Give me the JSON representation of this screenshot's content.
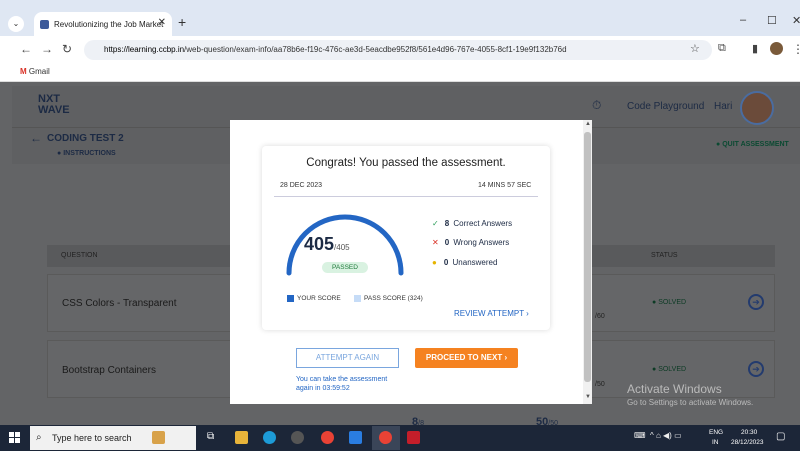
{
  "browser": {
    "tab_title": "Revolutionizing the Job Market",
    "url_host": "https://learning.ccbp.in",
    "url_path": "/web-question/exam-info/aa78b6e-f19c-476c-ae3d-5eacdbe952f8/561e4d96-767e-4055-8cf1-19e9f132b76d",
    "bookmark": "Gmail"
  },
  "app": {
    "logo_top": "NXT",
    "logo_bottom": "WAVE",
    "code_playground": "Code Playground",
    "user": "Hari",
    "test_title": "CODING TEST 2",
    "instructions": "INSTRUCTIONS",
    "quit": "QUIT ASSESSMENT",
    "col_question": "QUESTION",
    "col_status": "STATUS",
    "rows": [
      {
        "name": "CSS Colors - Transparent",
        "score_suffix": "/60",
        "status": "SOLVED"
      },
      {
        "name": "Bootstrap Containers",
        "score_suffix": "/50",
        "status": "SOLVED"
      }
    ],
    "partial_row": {
      "a": "8",
      "a_suffix": "/8",
      "b": "50",
      "b_suffix": "/50"
    }
  },
  "modal": {
    "congrats": "Congrats! You passed the assessment.",
    "date": "28 DEC 2023",
    "duration": "14 MINS 57 SEC",
    "score": "405",
    "total": "/405",
    "score_fraction": 1.0,
    "passed_label": "PASSED",
    "correct_count": "8",
    "correct_label": "Correct Answers",
    "wrong_count": "0",
    "wrong_label": "Wrong Answers",
    "unanswered_count": "0",
    "unanswered_label": "Unanswered",
    "legend_your": "YOUR SCORE",
    "legend_pass": "PASS SCORE (324)",
    "review": "REVIEW ATTEMPT",
    "attempt_again": "ATTEMPT AGAIN",
    "proceed": "PROCEED TO NEXT",
    "hint_line1": "You can take the assessment",
    "hint_line2": "again in 03:59:52",
    "colors": {
      "accent": "#2366c4",
      "proceed": "#f58220",
      "correct": "#2e9e5b",
      "wrong": "#d93025",
      "unanswered": "#e6b400"
    }
  },
  "windows": {
    "activate_title": "Activate Windows",
    "activate_sub": "Go to Settings to activate Windows.",
    "search_placeholder": "Type here to search",
    "lang1": "ENG",
    "lang2": "IN",
    "time": "20:30",
    "date": "28/12/2023"
  }
}
